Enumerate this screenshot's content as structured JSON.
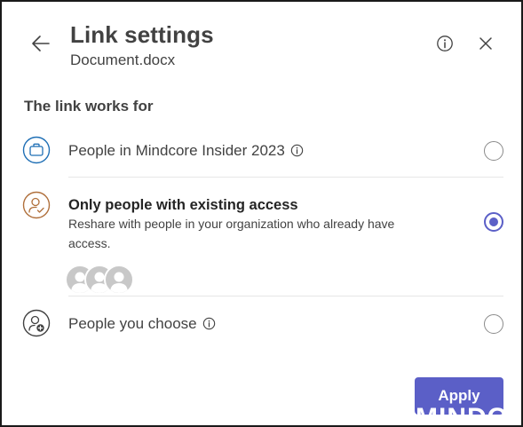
{
  "header": {
    "title": "Link settings",
    "subtitle": "Document.docx"
  },
  "section_label": "The link works for",
  "options": [
    {
      "label": "People in Mindcore Insider 2023",
      "icon": "briefcase-icon",
      "selected": false
    },
    {
      "label": "Only people with existing access",
      "description": "Reshare with people in your organization who already have access.",
      "icon": "person-check-icon",
      "selected": true
    },
    {
      "label": "People you choose",
      "icon": "person-add-icon",
      "selected": false
    }
  ],
  "footer": {
    "apply_label": "Apply"
  },
  "watermark": "MINDCORE",
  "colors": {
    "accent": "#5b5fc7",
    "briefcase_icon": "#1f6fb5",
    "person_icon": "#b0703c",
    "text": "#424242"
  }
}
